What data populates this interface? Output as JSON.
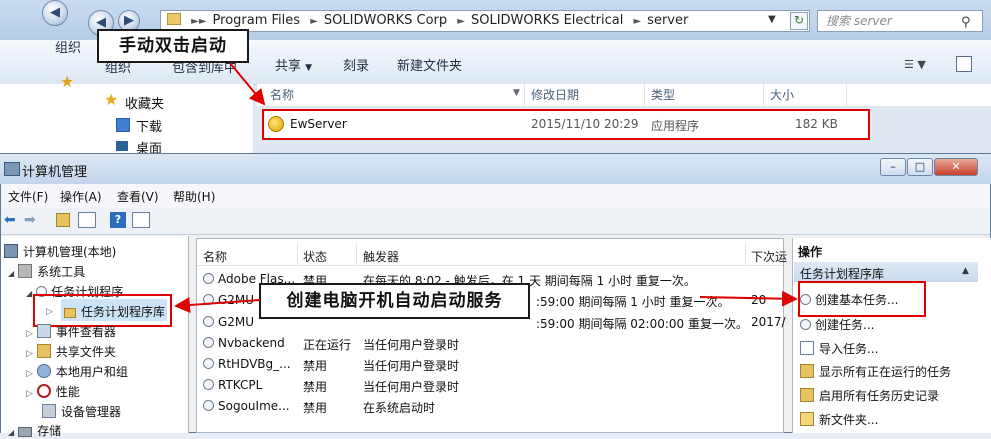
{
  "explorer": {
    "breadcrumb": [
      "Program Files",
      "SOLIDWORKS Corp",
      "SOLIDWORKS Electrical",
      "server"
    ],
    "search_placeholder": "搜索 server",
    "toolbar": {
      "organize": "组织",
      "include_in_library": "包含到库中",
      "share": "共享",
      "burn": "刻录",
      "new_folder": "新建文件夹"
    },
    "sidebar": {
      "favorites": "收藏夹",
      "downloads": "下载",
      "desktop": "桌面"
    },
    "columns": {
      "name": "名称",
      "modified": "修改日期",
      "type": "类型",
      "size": "大小"
    },
    "file": {
      "name": "EwServer",
      "modified": "2015/11/10 20:29",
      "type": "应用程序",
      "size": "182 KB"
    }
  },
  "callouts": {
    "double_click": "手动双击启动",
    "create_service": "创建电脑开机自动启动服务"
  },
  "mgmt": {
    "title": "计算机管理",
    "menu": [
      "文件(F)",
      "操作(A)",
      "查看(V)",
      "帮助(H)"
    ],
    "tree": [
      "计算机管理(本地)",
      "系统工具",
      "任务计划程序",
      "任务计划程序库",
      "事件查看器",
      "共享文件夹",
      "本地用户和组",
      "性能",
      "设备管理器",
      "存储"
    ],
    "list_headers": {
      "name": "名称",
      "status": "状态",
      "trigger": "触发器",
      "next_run": "下次运"
    },
    "tasks": [
      {
        "name": "Adobe Flas...",
        "status": "禁用",
        "trigger": "在每天的 8:02 - 触发后，在 1 天 期间每隔 1 小时 重复一次。",
        "next": ""
      },
      {
        "name": "G2MU",
        "status": "",
        "trigger": ":59:00 期间每隔 1 小时 重复一次。",
        "next": "20"
      },
      {
        "name": "G2MU",
        "status": "",
        "trigger": ":59:00 期间每隔 02:00:00 重复一次。",
        "next": "2017/"
      },
      {
        "name": "Nvbackend",
        "status": "正在运行",
        "trigger": "当任何用户登录时",
        "next": ""
      },
      {
        "name": "RtHDVBg_...",
        "status": "禁用",
        "trigger": "当任何用户登录时",
        "next": ""
      },
      {
        "name": "RTKCPL",
        "status": "禁用",
        "trigger": "当任何用户登录时",
        "next": ""
      },
      {
        "name": "SogouIme...",
        "status": "禁用",
        "trigger": "在系统启动时",
        "next": ""
      }
    ],
    "actions": {
      "header": "操作",
      "section": "任务计划程序库",
      "items": [
        "创建基本任务...",
        "创建任务...",
        "导入任务...",
        "显示所有正在运行的任务",
        "启用所有任务历史记录",
        "新文件夹..."
      ]
    }
  },
  "colors": {
    "highlight_red": "#e00000",
    "selection_blue": "#cde3f7"
  }
}
